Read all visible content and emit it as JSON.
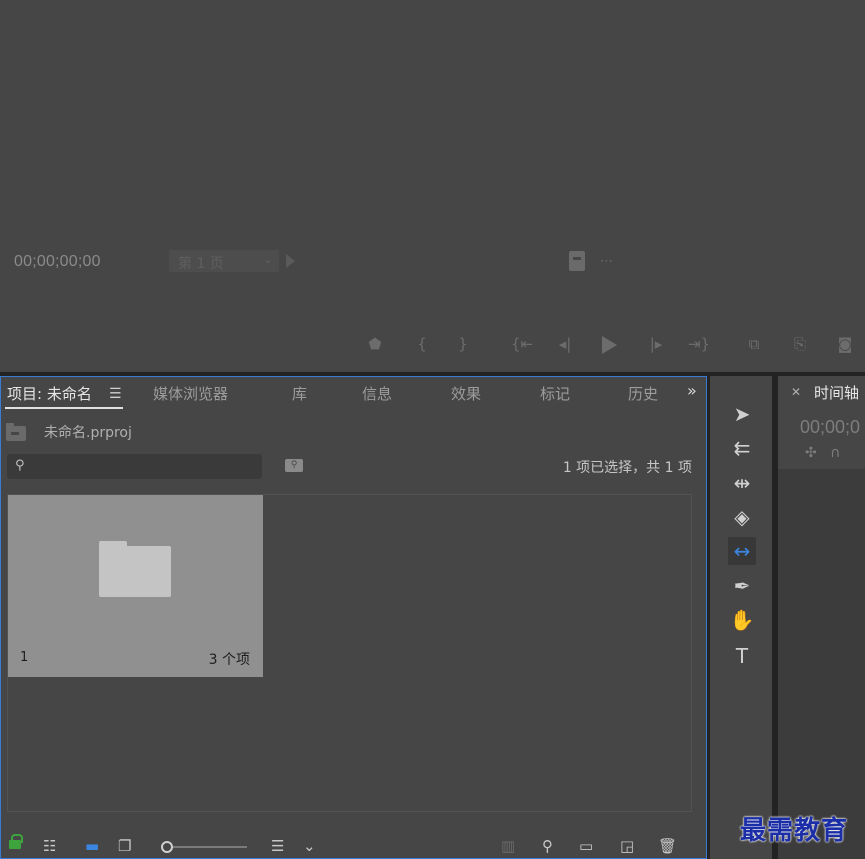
{
  "program_monitor": {
    "timecode": "00;00;00;00",
    "page_select": "第 1 页"
  },
  "project_panel": {
    "tabs": [
      {
        "label": "项目: 未命名",
        "active": true
      },
      {
        "label": "媒体浏览器"
      },
      {
        "label": "库"
      },
      {
        "label": "信息"
      },
      {
        "label": "效果"
      },
      {
        "label": "标记"
      },
      {
        "label": "历史"
      }
    ],
    "project_file": "未命名.prproj",
    "search": {
      "value": "",
      "placeholder": ""
    },
    "selection_status": "1 项已选择，共 1 项",
    "bins": [
      {
        "name": "1",
        "item_count": "3 个项"
      }
    ]
  },
  "tools": [
    {
      "name": "selection-tool",
      "icon": "arrow-cursor-icon"
    },
    {
      "name": "track-select-tool",
      "icon": "track-select-icon"
    },
    {
      "name": "ripple-edit-tool",
      "icon": "ripple-edit-icon"
    },
    {
      "name": "razor-tool",
      "icon": "razor-icon"
    },
    {
      "name": "slip-tool",
      "icon": "slip-icon",
      "active": true
    },
    {
      "name": "pen-tool",
      "icon": "pen-icon"
    },
    {
      "name": "hand-tool",
      "icon": "hand-icon"
    },
    {
      "name": "type-tool",
      "icon": "type-icon"
    }
  ],
  "timeline": {
    "title": "时间轴",
    "timecode": "00;00;0"
  },
  "watermark": "最需教育",
  "colors": {
    "accent": "#3a7bd5",
    "panel_bg": "#464646",
    "lock_green": "#3ea43e"
  }
}
